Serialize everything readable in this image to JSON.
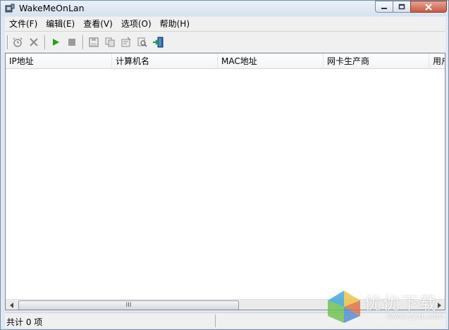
{
  "window": {
    "title": "WakeMeOnLan"
  },
  "menu": [
    "文件(F)",
    "编辑(E)",
    "查看(V)",
    "选项(O)",
    "帮助(H)"
  ],
  "toolbar": {
    "buttons": [
      {
        "name": "alarm-icon"
      },
      {
        "name": "delete-icon"
      },
      {
        "name": "play-icon"
      },
      {
        "name": "stop-icon"
      },
      {
        "name": "save-icon"
      },
      {
        "name": "copy-icon"
      },
      {
        "name": "properties-icon"
      },
      {
        "name": "find-icon"
      },
      {
        "name": "exit-icon"
      }
    ]
  },
  "table": {
    "columns": [
      "IP地址",
      "计算机名",
      "MAC地址",
      "网卡生产商",
      "用户"
    ],
    "rows": []
  },
  "scrollbar": {
    "grip": "III"
  },
  "status": {
    "text": "共计 0 项"
  },
  "watermark": {
    "text": "优优下载",
    "url": "www.yyxt.com"
  },
  "colors": {
    "play": "#1aa31a",
    "stop": "#9a9a9a",
    "close_button": "#c85b44"
  }
}
